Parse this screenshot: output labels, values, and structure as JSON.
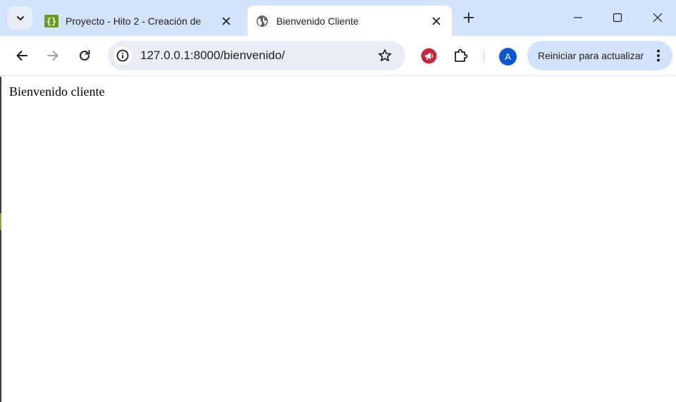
{
  "tabs": [
    {
      "title": "Proyecto - Hito 2 - Creación de",
      "favicon": "overleaf-icon",
      "active": false
    },
    {
      "title": "Bienvenido Cliente",
      "favicon": "globe-icon",
      "active": true
    }
  ],
  "omnibox": {
    "url": "127.0.0.1:8000/bienvenido/"
  },
  "toolbar": {
    "avatar_initial": "A",
    "update_label": "Reiniciar para actualizar"
  },
  "page": {
    "text": "Bienvenido cliente"
  },
  "colors": {
    "tabstrip_bg": "#d3e3fd",
    "omnibox_bg": "#e9eef6",
    "avatar_bg": "#0b57d0",
    "extension_red": "#c5283d"
  }
}
